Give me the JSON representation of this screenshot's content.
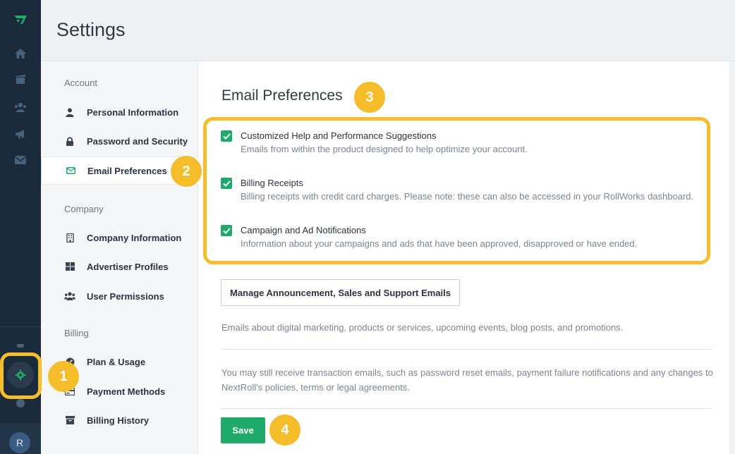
{
  "header": {
    "title": "Settings"
  },
  "rail": {
    "icons": [
      "logo-icon",
      "home-icon",
      "shop-icon",
      "audience-icon",
      "megaphone-icon",
      "mail-icon",
      "plug-icon",
      "gear-icon",
      "help-icon"
    ],
    "avatar_initial": "R"
  },
  "subnav": {
    "groups": {
      "account": "Account",
      "company": "Company",
      "billing": "Billing"
    },
    "items": [
      {
        "label": "Personal Information",
        "icon": "user-icon"
      },
      {
        "label": "Password and Security",
        "icon": "lock-icon"
      },
      {
        "label": "Email Preferences",
        "icon": "envelope-icon",
        "active": true
      },
      {
        "label": "Company Information",
        "icon": "building-icon"
      },
      {
        "label": "Advertiser Profiles",
        "icon": "grid-icon"
      },
      {
        "label": "User Permissions",
        "icon": "users-icon"
      },
      {
        "label": "Plan & Usage",
        "icon": "gauge-icon"
      },
      {
        "label": "Payment Methods",
        "icon": "credit-card-icon"
      },
      {
        "label": "Billing History",
        "icon": "archive-icon"
      }
    ]
  },
  "main": {
    "title": "Email Preferences",
    "preferences": [
      {
        "title": "Customized Help and Performance Suggestions",
        "description": "Emails from within the product designed to help optimize your account.",
        "checked": true
      },
      {
        "title": "Billing Receipts",
        "description": "Billing receipts with credit card charges. Please note: these can also be accessed in your RollWorks dashboard.",
        "checked": true
      },
      {
        "title": "Campaign and Ad Notifications",
        "description": "Information about your campaigns and ads that have been approved, disapproved or have ended.",
        "checked": true
      }
    ],
    "manage_button": "Manage Announcement, Sales and Support Emails",
    "manage_info": "Emails about digital marketing, products or services, upcoming events, blog posts, and promotions.",
    "transaction_info": "You may still receive transaction emails, such as password reset emails, payment failure notifications and any changes to NextRoll's policies, terms or legal agreements.",
    "save_button": "Save"
  },
  "callouts": [
    "1",
    "2",
    "3",
    "4"
  ],
  "colors": {
    "accent": "#1eaa6a",
    "highlight": "#f5bd2a",
    "rail": "#1b2a3a"
  }
}
